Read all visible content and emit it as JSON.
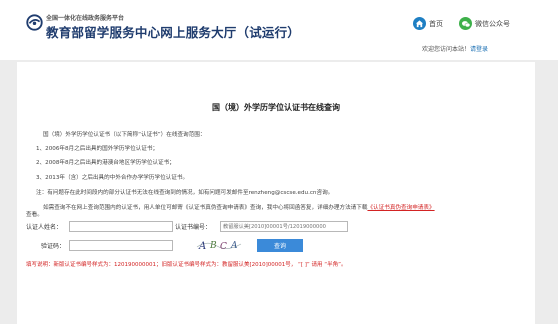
{
  "header": {
    "org_line": "全国一体化在线政务服务平台",
    "site_title": "教育部留学服务中心网上服务大厅（试运行）",
    "home_label": "首页",
    "wechat_label": "微信公众号",
    "welcome_text": "欢迎您访问本站！",
    "login_label": "请登录"
  },
  "main": {
    "page_title": "国（境）外学历学位认证书在线查询",
    "intro": "国（境）外学历学位认证书（以下简称“认证书”）在线查询范围：",
    "items": [
      "1、2006年8月之后出具的国外学历学位认证书；",
      "2、2008年8月之后出具的港澳台地区学历学位认证书；",
      "3、2013年（含）之后出具的中外合作办学学历学位认证书。"
    ],
    "note": "注：有问题存在此时间段内的部分认证书无法在线查询到的情况，如有问题可发邮件至renzheng@cscse.edu.cn咨询。",
    "contact_prefix": "如需查询不在网上查询范围内的认证书，用人单位可邮寄《认证书真伪查询申请表》查询，我中心将回函答复，详细办理方法请下载",
    "contact_link": "《认证书真伪查询申请表》",
    "contact_suffix": "查看。"
  },
  "form": {
    "name_label": "认证人姓名：",
    "name_value": "",
    "cert_label": "认证书编号：",
    "cert_placeholder": "教留服认美[2010]00001号/12019000000",
    "captcha_label": "验证码：",
    "captcha_value": "",
    "captcha_chars": "ABCA",
    "query_label": "查询",
    "tip": "填写说明：新版认证书编号样式为：120190000001；旧版认证书编号样式为：教留服认美[2010]00001号， “[ ]” 请用 “半角”。"
  },
  "colors": {
    "brand": "#1f3c6e",
    "home_icon": "#1e7fc3",
    "wechat_icon": "#3db04a",
    "button": "#3b8ad9",
    "warning": "#d32323"
  }
}
